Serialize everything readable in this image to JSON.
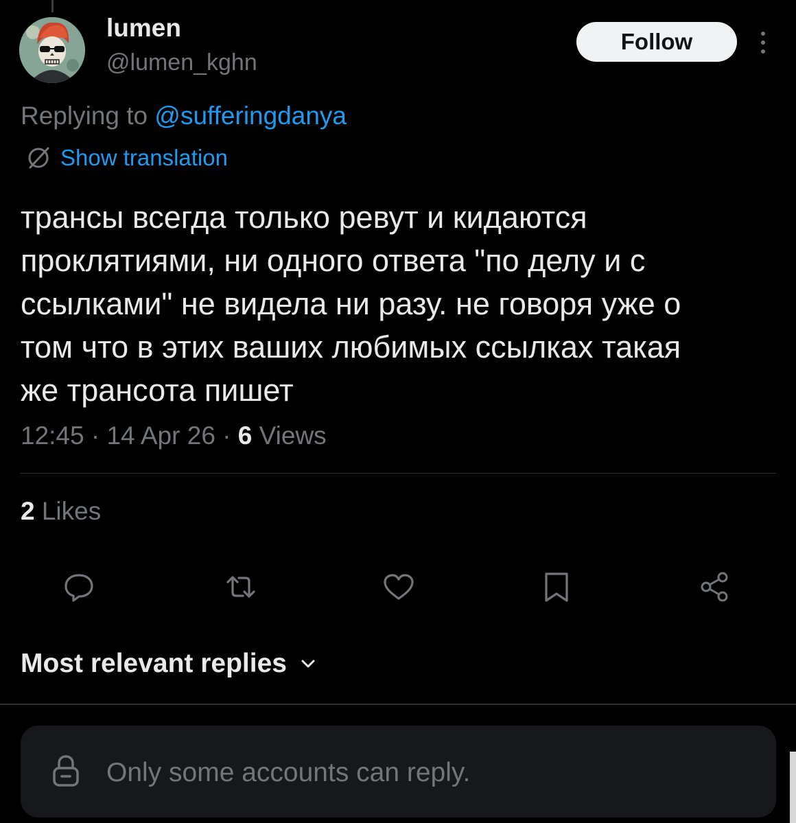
{
  "user": {
    "display_name": "lumen",
    "handle": "@lumen_kghn",
    "avatar_icon": "skull-avatar-icon"
  },
  "follow_label": "Follow",
  "replying": {
    "prefix": "Replying to ",
    "mention": "@sufferingdanya"
  },
  "translation_label": "Show translation",
  "tweet": {
    "lines": [
      "трансы всегда только ревут и кидаются",
      "проклятиями, ни одного ответа \"по делу и с",
      "ссылками\" не видела ни разу. не говоря уже о",
      "том что в этих ваших любимых ссылках такая",
      "же трансота пишет"
    ],
    "time": "12:45",
    "date": "14 Apr 26",
    "separator": " · ",
    "views_count": "6",
    "views_label": " Views"
  },
  "likes": {
    "count": "2",
    "label": " Likes"
  },
  "actions": [
    {
      "icon": "reply-icon"
    },
    {
      "icon": "retweet-icon"
    },
    {
      "icon": "heart-icon"
    },
    {
      "icon": "bookmark-icon"
    },
    {
      "icon": "share-icon"
    }
  ],
  "replies_sort_label": "Most relevant replies",
  "reply_restriction_text": "Only some accounts can reply.",
  "colors": {
    "background": "#000000",
    "text": "#e7e9ea",
    "secondary": "#71767b",
    "accent": "#1d9bf0",
    "divider": "#2f3336"
  }
}
